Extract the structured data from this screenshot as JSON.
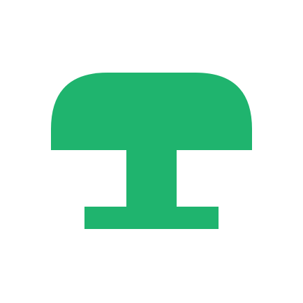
{
  "logo": {
    "icon": "mushroom-table-icon",
    "color": "#1fb46e",
    "background": "#ffffff"
  }
}
